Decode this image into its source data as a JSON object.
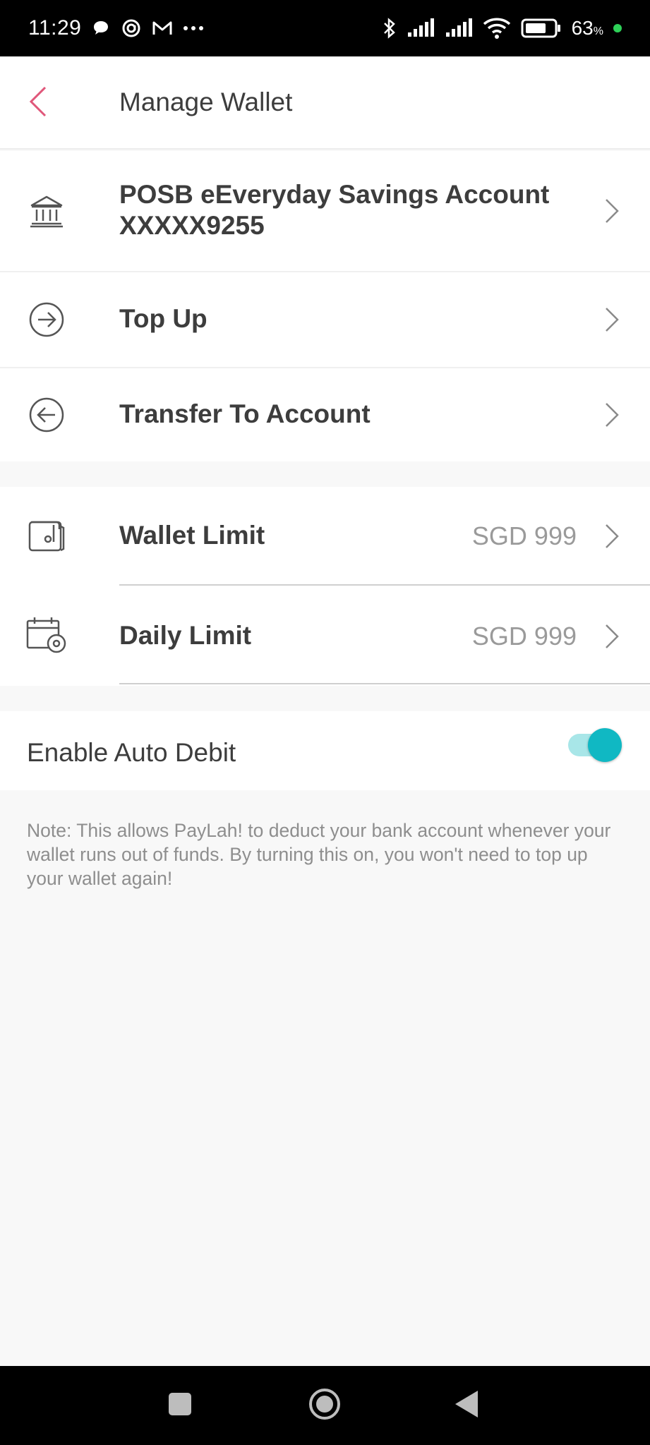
{
  "status_bar": {
    "time": "11:29",
    "battery": "63",
    "battery_unit": "%"
  },
  "header": {
    "title": "Manage Wallet"
  },
  "account": {
    "name": "POSB eEveryday Savings Account",
    "number": "XXXXX9255"
  },
  "actions": {
    "top_up": "Top Up",
    "transfer": "Transfer To Account"
  },
  "limits": {
    "wallet_limit_label": "Wallet Limit",
    "wallet_limit_value": "SGD 999",
    "daily_limit_label": "Daily Limit",
    "daily_limit_value": "SGD 999"
  },
  "auto_debit": {
    "label": "Enable Auto Debit",
    "enabled": true,
    "note": "Note: This allows PayLah! to deduct your bank account whenever your wallet runs out of funds. By turning this on, you won't need to top up your wallet again!"
  },
  "colors": {
    "accent": "#e0577a",
    "toggle_on": "#10b8c3",
    "toggle_track": "#a8e6e8"
  },
  "icons": {
    "back": "chevron-left-icon",
    "bank": "bank-icon",
    "top_up": "arrow-right-circle-icon",
    "transfer": "arrow-left-circle-icon",
    "wallet": "wallet-icon",
    "calendar_settings": "calendar-gear-icon"
  }
}
